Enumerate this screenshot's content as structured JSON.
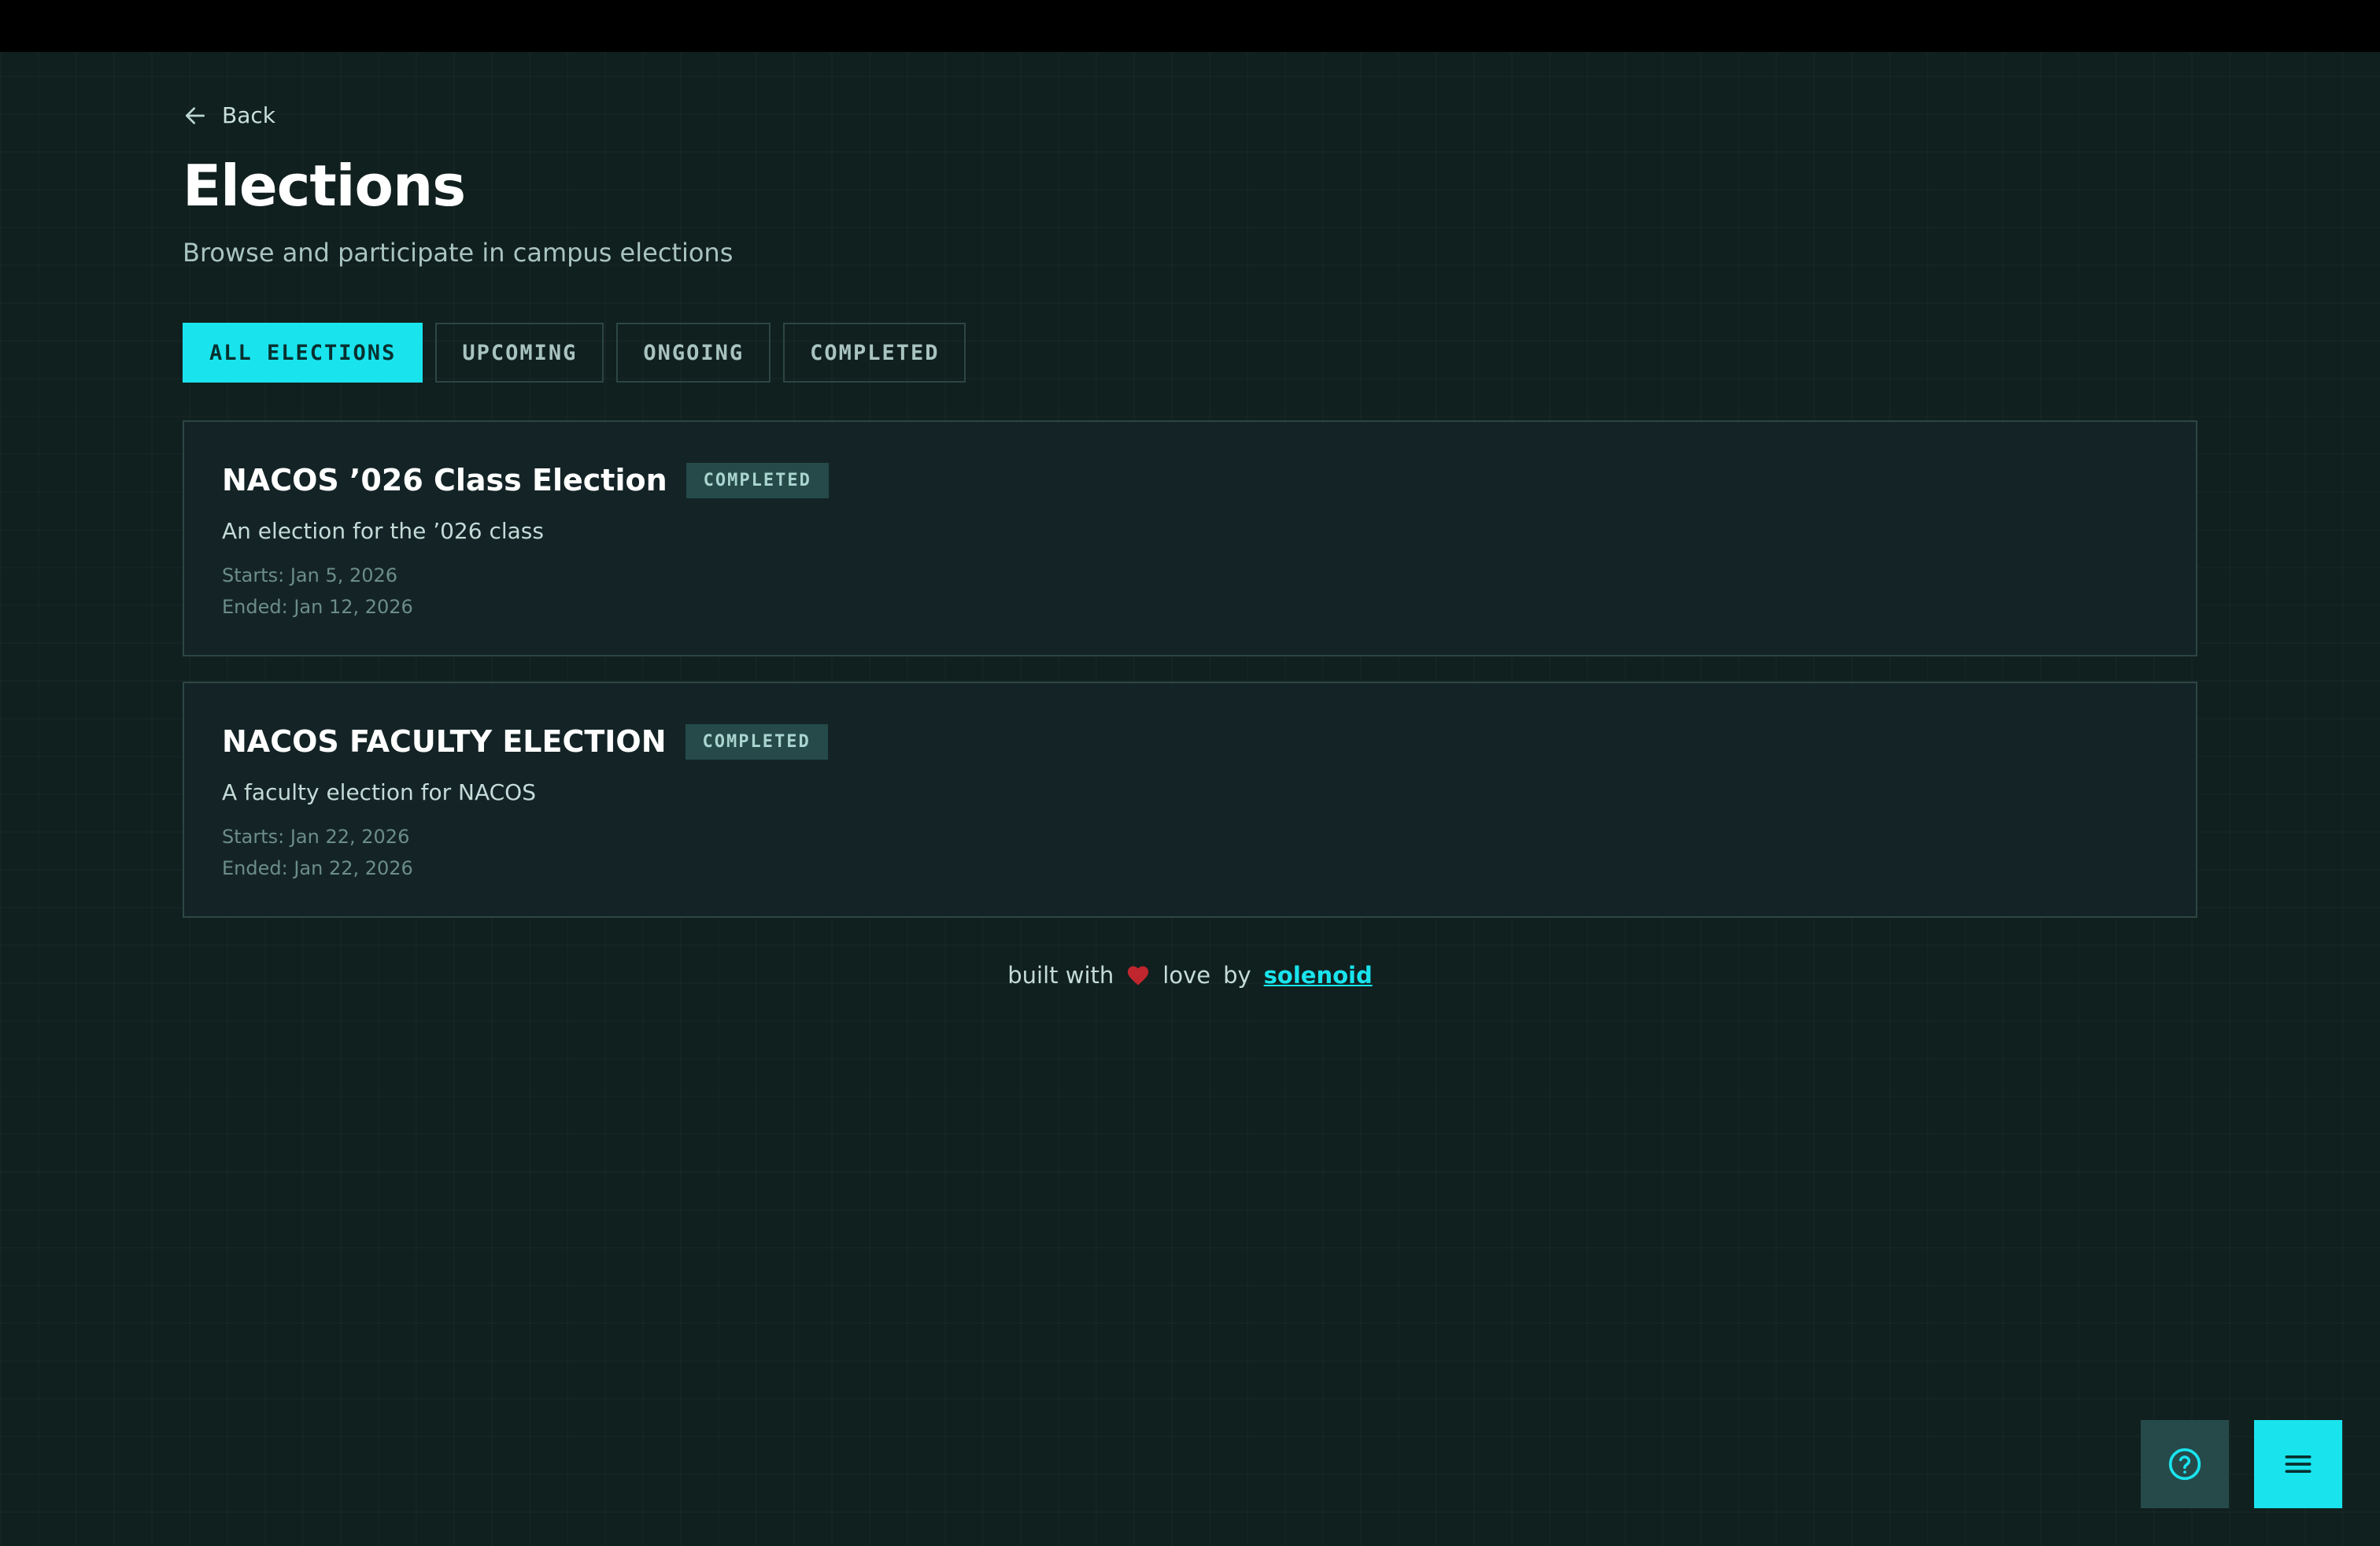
{
  "nav": {
    "back_label": "Back"
  },
  "header": {
    "title": "Elections",
    "subtitle": "Browse and participate in campus elections"
  },
  "filters": [
    {
      "label": "ALL ELECTIONS",
      "active": true
    },
    {
      "label": "UPCOMING",
      "active": false
    },
    {
      "label": "ONGOING",
      "active": false
    },
    {
      "label": "COMPLETED",
      "active": false
    }
  ],
  "elections": [
    {
      "title": "NACOS ’026 Class Election",
      "status": "COMPLETED",
      "description": "An election for the ’026 class",
      "starts": "Starts: Jan 5, 2026",
      "ended": "Ended: Jan 12, 2026"
    },
    {
      "title": "NACOS FACULTY ELECTION",
      "status": "COMPLETED",
      "description": "A faculty election for NACOS",
      "starts": "Starts: Jan 22, 2026",
      "ended": "Ended: Jan 22, 2026"
    }
  ],
  "footer": {
    "text_before": "built with",
    "text_middle": "love",
    "text_by": "by",
    "link": "solenoid"
  },
  "icons": {
    "back": "arrow-left-icon",
    "heart": "heart-icon",
    "help": "help-circle-icon",
    "menu": "hamburger-menu-icon"
  },
  "colors": {
    "background": "#10201f",
    "accent": "#19e4ee",
    "card_background": "#142426",
    "badge_background": "#264a4a",
    "heart": "#c0262d"
  }
}
